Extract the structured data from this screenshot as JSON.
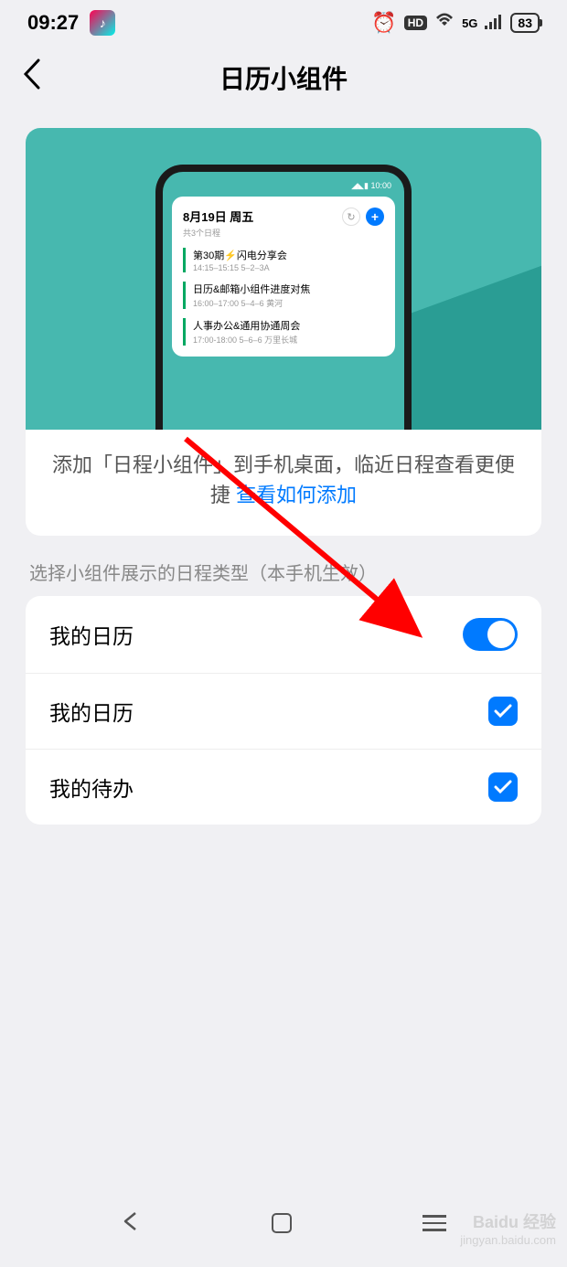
{
  "status_bar": {
    "time": "09:27",
    "hd": "HD",
    "network": "5G",
    "battery": "83"
  },
  "header": {
    "title": "日历小组件"
  },
  "preview": {
    "mock_status": "◢◣▮ 10:00",
    "widget": {
      "date": "8月19日 周五",
      "count": "共3个日程",
      "events": [
        {
          "title": "第30期⚡闪电分享会",
          "time": "14:15–15:15  5–2–3A"
        },
        {
          "title": "日历&邮箱小组件进度对焦",
          "time": "16:00–17:00  5–4–6 黄河"
        },
        {
          "title": "人事办公&通用协通周会",
          "time": "17:00-18:00  5–6–6 万里长城"
        }
      ]
    },
    "desc_1": "添加「日程小组件」到手机桌面，临近日程查看更便捷 ",
    "desc_link": "查看如何添加"
  },
  "section_label": "选择小组件展示的日程类型（本手机生效）",
  "settings": [
    {
      "label": "我的日历",
      "type": "toggle"
    },
    {
      "label": "我的日历",
      "type": "checkbox"
    },
    {
      "label": "我的待办",
      "type": "checkbox"
    }
  ],
  "watermark": {
    "main": "Baidu 经验",
    "sub": "jingyan.baidu.com"
  }
}
